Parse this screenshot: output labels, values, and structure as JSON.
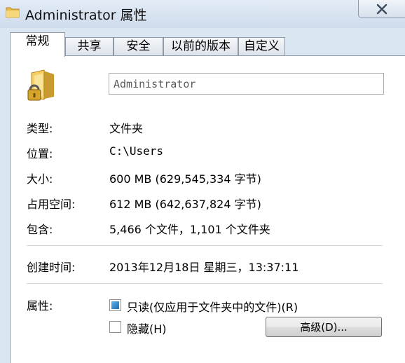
{
  "window": {
    "title": "Administrator 属性",
    "close_glyph": "✕"
  },
  "tabs": [
    {
      "label": "常规",
      "active": true
    },
    {
      "label": "共享",
      "active": false
    },
    {
      "label": "安全",
      "active": false
    },
    {
      "label": "以前的版本",
      "active": false
    },
    {
      "label": "自定义",
      "active": false
    }
  ],
  "general": {
    "folder_name": "Administrator",
    "rows": [
      {
        "label": "类型:",
        "value": "文件夹"
      },
      {
        "label": "位置:",
        "value": "C:\\Users"
      },
      {
        "label": "大小:",
        "value": "600 MB (629,545,334 字节)"
      },
      {
        "label": "占用空间:",
        "value": "612 MB (642,637,824 字节)"
      },
      {
        "label": "包含:",
        "value": "5,466 个文件，1,101 个文件夹"
      }
    ],
    "created_label": "创建时间:",
    "created_value": "2013年12月18日 星期三，13:37:11",
    "attributes_label": "属性:",
    "readonly_label": "只读(仅应用于文件夹中的文件)(R)",
    "readonly_state": "indeterminate",
    "hidden_label": "隐藏(H)",
    "hidden_checked": false,
    "advanced_button": "高级(D)..."
  },
  "icons": {
    "title": "folder-icon",
    "main": "locked-folder-icon",
    "close": "close-icon"
  },
  "colors": {
    "window_frame": "#dbe6f3",
    "checkbox_fill": "#1a6cb5"
  }
}
